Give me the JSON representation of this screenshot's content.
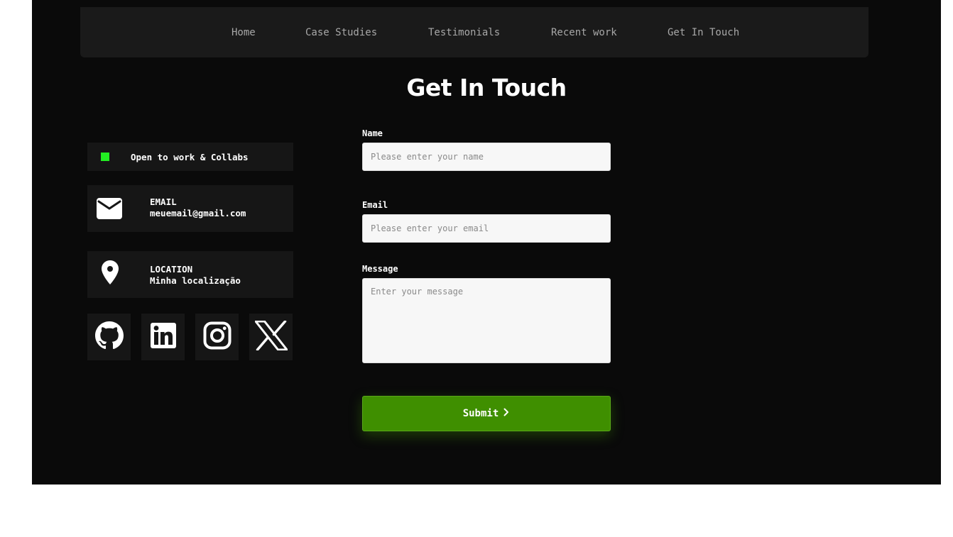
{
  "nav": {
    "items": [
      {
        "label": "Home"
      },
      {
        "label": "Case Studies"
      },
      {
        "label": "Testimonials"
      },
      {
        "label": "Recent work"
      },
      {
        "label": "Get In Touch"
      }
    ]
  },
  "title": "Get In Touch",
  "status": {
    "text": "Open to work & Collabs",
    "dot_color": "#22ee22"
  },
  "email_card": {
    "label": "EMAIL",
    "value": "meuemail@gmail.com",
    "icon": "envelope-icon"
  },
  "location_card": {
    "label": "LOCATION",
    "value": "Minha localização",
    "icon": "map-pin-icon"
  },
  "socials": [
    {
      "icon": "github-icon"
    },
    {
      "icon": "linkedin-icon"
    },
    {
      "icon": "instagram-icon"
    },
    {
      "icon": "x-icon"
    }
  ],
  "form": {
    "name_label": "Name",
    "name_placeholder": "Please enter your name",
    "email_label": "Email",
    "email_placeholder": "Please enter your email",
    "message_label": "Message",
    "message_placeholder": "Enter your message",
    "submit_label": "Submit",
    "submit_color": "#3f8f00"
  }
}
